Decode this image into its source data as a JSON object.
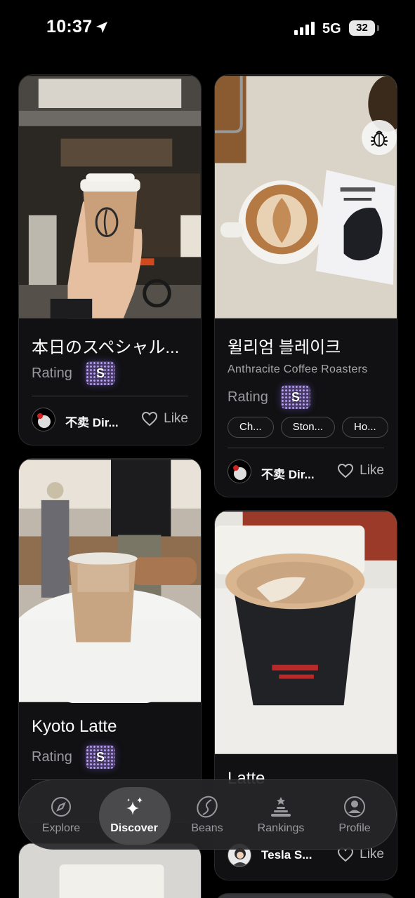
{
  "status_bar": {
    "time": "10:37",
    "network": "5G",
    "battery": "32"
  },
  "cards": [
    {
      "title": "本日のスペシャル...",
      "rating_label": "Rating",
      "rating_grade": "S",
      "author": "不卖 Dir...",
      "like_label": "Like"
    },
    {
      "title": "윌리엄 블레이크",
      "roaster": "Anthracite Coffee Roasters",
      "rating_label": "Rating",
      "rating_grade": "S",
      "notes": [
        "Ch...",
        "Ston...",
        "Ho..."
      ],
      "author": "不卖 Dir...",
      "like_label": "Like"
    },
    {
      "title": "Kyoto Latte",
      "rating_label": "Rating",
      "rating_grade": "S"
    },
    {
      "title": "Latte",
      "author": "Tesla S...",
      "like_label": "Like"
    }
  ],
  "tabs": [
    {
      "label": "Explore",
      "icon": "compass-icon"
    },
    {
      "label": "Discover",
      "icon": "sparkles-icon",
      "active": true
    },
    {
      "label": "Beans",
      "icon": "coffee-bean-icon"
    },
    {
      "label": "Rankings",
      "icon": "podium-icon"
    },
    {
      "label": "Profile",
      "icon": "profile-icon"
    }
  ]
}
